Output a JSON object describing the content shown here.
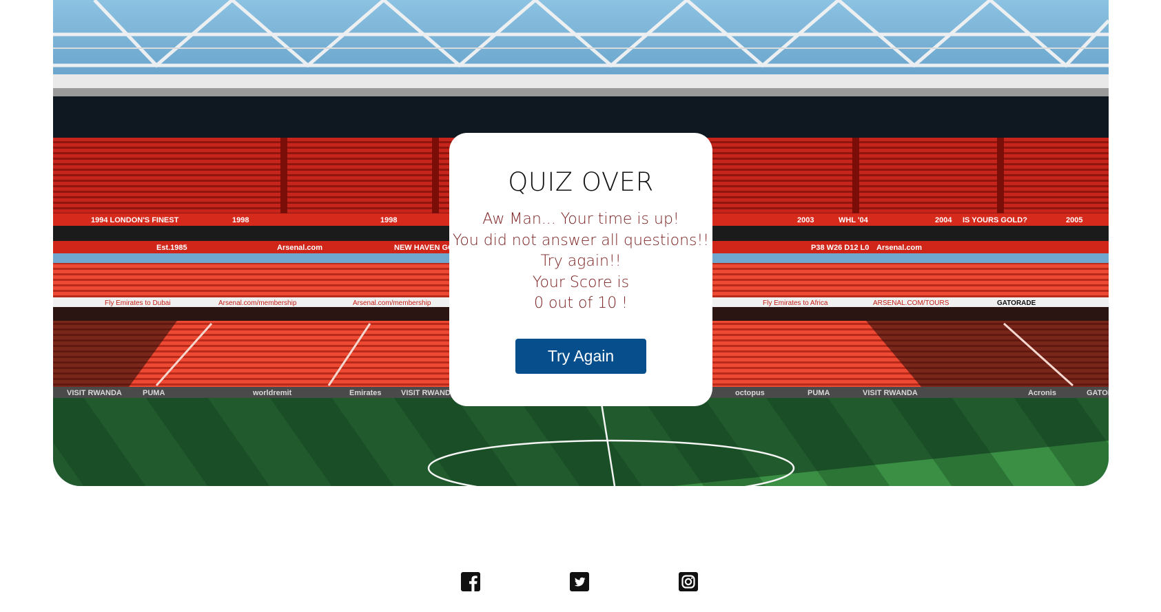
{
  "hero": {
    "image": "stadium-background",
    "banner_texts": [
      "1994 LONDON'S FINEST",
      "1998",
      "1998",
      "2003",
      "WHL '04",
      "2004",
      "IS YOURS GOLD?",
      "2005",
      "Est.1985",
      "Arsenal.com",
      "NEW HAVEN GOONERS",
      "P38 W26 D12 L0",
      "Arsenal.com",
      "Fly Emirates to Dubai",
      "Arsenal.com/membership",
      "Arsenal.com/membership",
      "Fly Emirates to Africa",
      "ARSENAL.COM/TOURS",
      "GATORADE",
      "VISIT RWANDA",
      "PUMA",
      "worldremit",
      "Emirates",
      "VISIT RWANDA",
      "octopus",
      "PUMA",
      "VISIT RWANDA",
      "Acronis",
      "GATORA"
    ]
  },
  "quiz": {
    "title": "QUIZ OVER",
    "messages": [
      "Aw Man... Your time is up!",
      "You did not answer all questions!!",
      "Try again!!",
      "Your Score is",
      "0 out of 10 !"
    ],
    "button_label": "Try Again"
  },
  "footer": {
    "social_icons": [
      "facebook-icon",
      "twitter-icon",
      "instagram-icon"
    ]
  },
  "colors": {
    "button": "#064f8c",
    "message_text": "#7a1f1f",
    "title_text": "#111111"
  }
}
